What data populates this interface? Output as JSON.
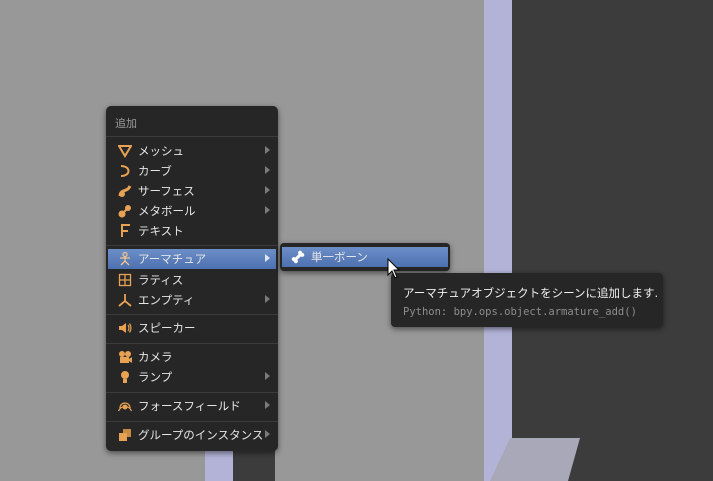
{
  "menu": {
    "title": "追加",
    "items": [
      {
        "label": "メッシュ",
        "icon": "mesh-icon",
        "has_submenu": true
      },
      {
        "label": "カーブ",
        "icon": "curve-icon",
        "has_submenu": true
      },
      {
        "label": "サーフェス",
        "icon": "surface-icon",
        "has_submenu": true
      },
      {
        "label": "メタボール",
        "icon": "metaball-icon",
        "has_submenu": true
      },
      {
        "label": "テキスト",
        "icon": "text-icon",
        "has_submenu": false
      },
      {
        "label": "アーマチュア",
        "icon": "armature-icon",
        "has_submenu": true,
        "active": true
      },
      {
        "label": "ラティス",
        "icon": "lattice-icon",
        "has_submenu": false
      },
      {
        "label": "エンプティ",
        "icon": "empty-icon",
        "has_submenu": true
      },
      {
        "label": "スピーカー",
        "icon": "speaker-icon",
        "has_submenu": false
      },
      {
        "label": "カメラ",
        "icon": "camera-icon",
        "has_submenu": false
      },
      {
        "label": "ランプ",
        "icon": "lamp-icon",
        "has_submenu": true
      },
      {
        "label": "フォースフィールド",
        "icon": "force-field-icon",
        "has_submenu": true
      },
      {
        "label": "グループのインスタンス",
        "icon": "group-instance-icon",
        "has_submenu": true
      }
    ]
  },
  "submenu": {
    "items": [
      {
        "label": "単一ボーン",
        "icon": "bone-icon"
      }
    ]
  },
  "tooltip": {
    "description": "アーマチュアオブジェクトをシーンに追加します.",
    "python": "Python: bpy.ops.object.armature_add()"
  },
  "colors": {
    "highlight": "#5a7dbd",
    "menu_bg": "#262626",
    "icon_orange": "#e8a254"
  }
}
